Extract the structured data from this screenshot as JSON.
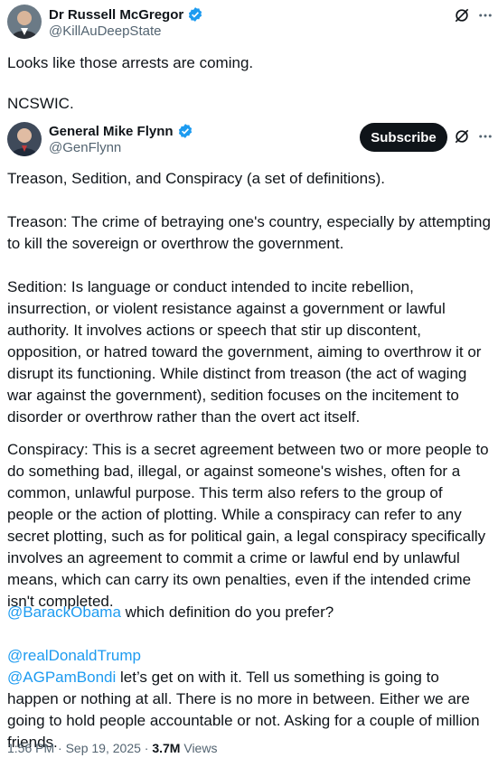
{
  "outer_tweet": {
    "author_name": "Dr Russell McGregor",
    "handle": "@KillAuDeepState",
    "line1": "Looks like those arrests are coming.",
    "line2": "NCSWIC.",
    "avatar_icon": "avatar-photo-icon",
    "verified_icon": "verified-badge-icon",
    "action_icons": [
      "grok-icon",
      "more-icon"
    ]
  },
  "quoted_tweet": {
    "author_name": "General Mike Flynn",
    "handle": "@GenFlynn",
    "subscribe_label": "Subscribe",
    "paragraphs": {
      "p1": "Treason, Sedition, and Conspiracy (a set of definitions).",
      "p2": "Treason: The crime of betraying one's country, especially by attempting to kill the sovereign or overthrow the government.",
      "p3": "Sedition: Is language or conduct intended to incite rebellion, insurrection, or violent resistance against a government or lawful authority. It involves actions or speech that stir up discontent, opposition, or hatred toward the government, aiming to overthrow it or disrupt its functioning. While distinct from treason (the act of waging war against the government), sedition focuses on the incitement to disorder or overthrow rather than the overt act itself.",
      "p4": "Conspiracy: This is a secret agreement between two or more people to do something bad, illegal, or against someone's wishes, often for a common, unlawful purpose. This term also refers to the group of people or the action of plotting. While a conspiracy can refer to any secret plotting, such as for political gain, a legal conspiracy specifically involves an agreement to commit a crime or lawful end by unlawful means, which can carry its own penalties, even if the intended crime isn't completed."
    },
    "mention_obama": "@BarackObama",
    "obama_text": " which definition do you prefer?",
    "mention_trump": "@realDonaldTrump",
    "mention_bondi": "@AGPamBondi",
    "bondi_text": " let’s get on with it. Tell us something is going to happen or nothing at all. There is no more in between. Either we are going to hold people accountable or not. Asking for a couple of million friends.",
    "time": "1:56 PM",
    "sep": " · ",
    "date": "Sep 19, 2025",
    "views_count": "3.7M",
    "views_label": " Views"
  },
  "colors": {
    "text": "#0f1419",
    "secondary": "#536471",
    "link": "#1d9bf0",
    "verified": "#1d9bf0",
    "button_bg": "#0f1419"
  }
}
